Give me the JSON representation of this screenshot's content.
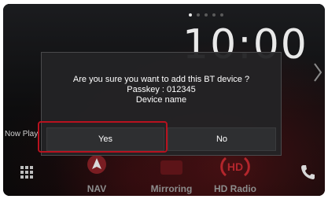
{
  "home": {
    "clock": "10:00",
    "now_playing": "Now Playing",
    "page_count": 5,
    "active_page": 1
  },
  "dock": {
    "apps_icon": "grid-icon",
    "tiles": [
      {
        "label": "NAV",
        "icon": "nav-icon"
      },
      {
        "label": "Mirroring",
        "icon": "mirroring-icon"
      },
      {
        "label": "HD Radio",
        "icon": "hd-radio-icon"
      }
    ],
    "phone_icon": "phone-icon"
  },
  "dialog": {
    "line1": "Are you sure you want to add this BT device ?",
    "line2": "Passkey : 012345",
    "line3": "Device name",
    "yes_label": "Yes",
    "no_label": "No"
  },
  "colors": {
    "highlight": "#b8121f",
    "dialog_bg": "#232325",
    "accent_red": "#8a1a20"
  }
}
